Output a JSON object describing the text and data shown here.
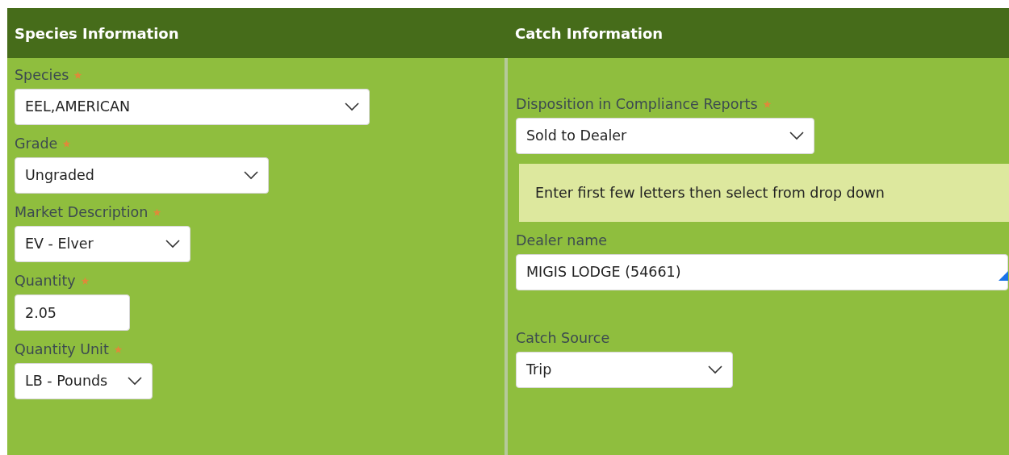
{
  "sections": [
    {
      "title": "Species Information",
      "fields": [
        {
          "label": "Species",
          "required": true,
          "kind": "select",
          "value": "EEL,AMERICAN"
        },
        {
          "label": "Grade",
          "required": true,
          "kind": "select",
          "value": "Ungraded"
        },
        {
          "label": "Market Description",
          "required": true,
          "kind": "select",
          "value": "EV - Elver"
        },
        {
          "label": "Quantity",
          "required": true,
          "kind": "input",
          "value": "2.05"
        },
        {
          "label": "Quantity Unit",
          "required": true,
          "kind": "select",
          "value": "LB - Pounds"
        }
      ]
    },
    {
      "title": "Catch Information",
      "fields": [
        {
          "kind": "gap"
        },
        {
          "label": "Disposition in Compliance Reports",
          "required": true,
          "kind": "select",
          "value": "Sold to Dealer"
        },
        {
          "kind": "hint",
          "text": "Enter first few letters then select from drop down"
        },
        {
          "label": "Dealer name",
          "required": false,
          "kind": "textarea",
          "value": "MIGIS LODGE (54661)"
        },
        {
          "kind": "gap"
        },
        {
          "label": "Catch Source",
          "required": false,
          "kind": "select",
          "value": "Trip"
        }
      ]
    }
  ]
}
